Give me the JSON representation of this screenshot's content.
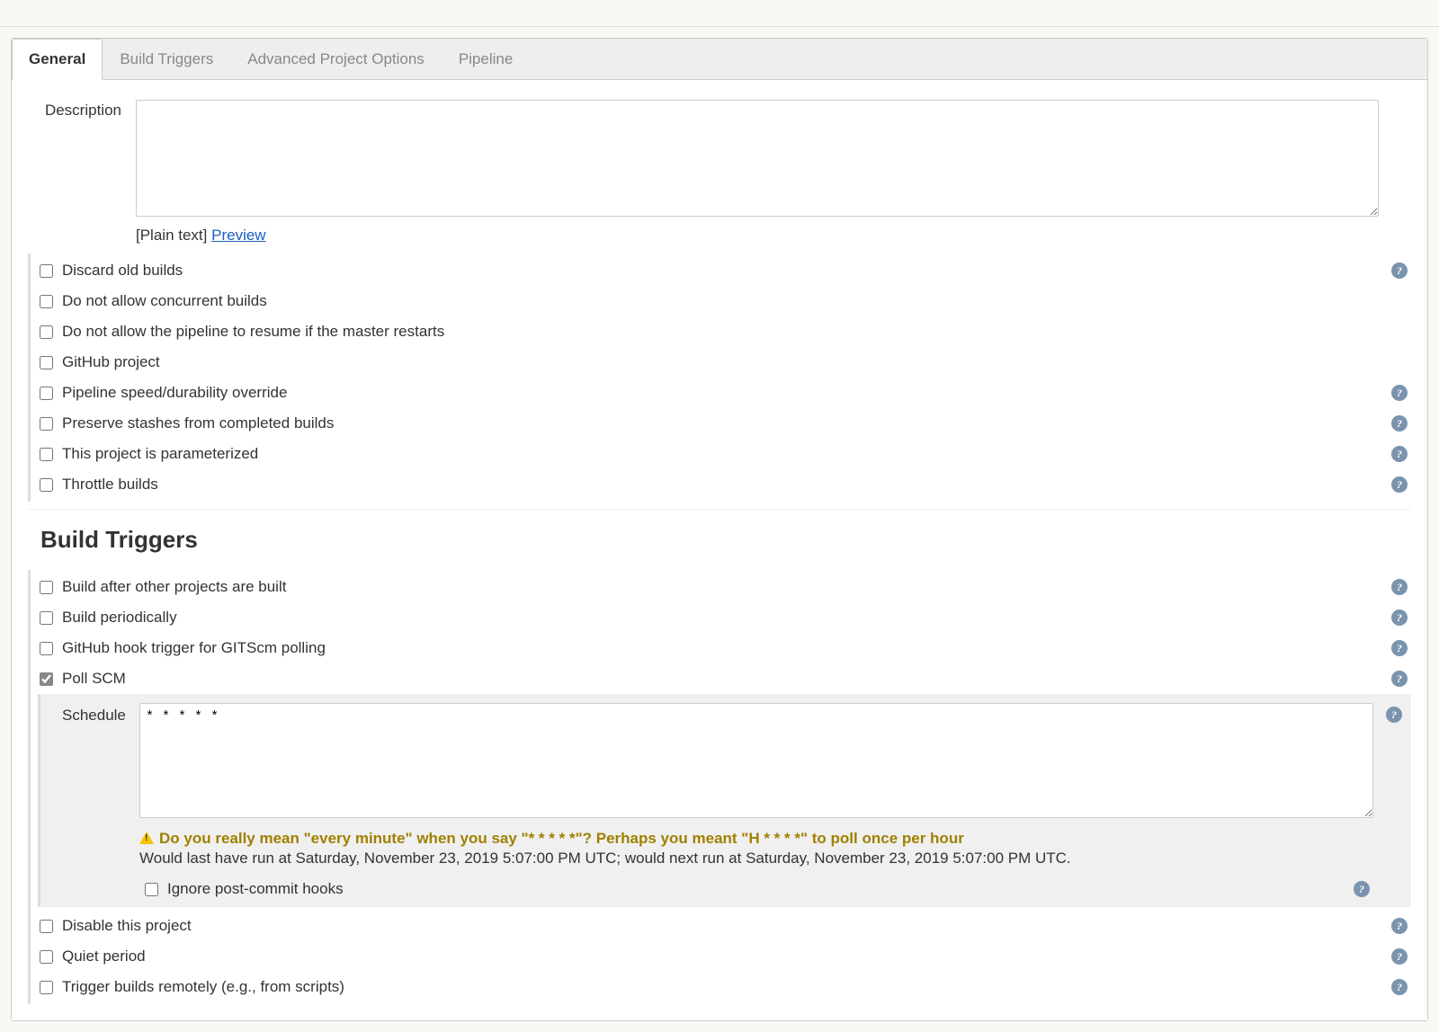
{
  "tabs": {
    "general": "General",
    "build_triggers": "Build Triggers",
    "advanced": "Advanced Project Options",
    "pipeline": "Pipeline"
  },
  "description": {
    "label": "Description",
    "value": "",
    "plain_text": "[Plain text]",
    "preview": "Preview"
  },
  "general_options": {
    "discard_old_builds": "Discard old builds",
    "no_concurrent": "Do not allow concurrent builds",
    "no_resume": "Do not allow the pipeline to resume if the master restarts",
    "github_project": "GitHub project",
    "speed_durability": "Pipeline speed/durability override",
    "preserve_stashes": "Preserve stashes from completed builds",
    "parameterized": "This project is parameterized",
    "throttle": "Throttle builds"
  },
  "build_triggers_section": {
    "heading": "Build Triggers",
    "build_after": "Build after other projects are built",
    "build_periodically": "Build periodically",
    "github_hook": "GitHub hook trigger for GITScm polling",
    "poll_scm": "Poll SCM"
  },
  "schedule": {
    "label": "Schedule",
    "value": "* * * * *",
    "warning": "Do you really mean \"every minute\" when you say \"* * * * *\"? Perhaps you meant \"H * * * *\" to poll once per hour",
    "info": "Would last have run at Saturday, November 23, 2019 5:07:00 PM UTC; would next run at Saturday, November 23, 2019 5:07:00 PM UTC.",
    "ignore_hooks": "Ignore post-commit hooks"
  },
  "more_options": {
    "disable_project": "Disable this project",
    "quiet_period": "Quiet period",
    "trigger_remote": "Trigger builds remotely (e.g., from scripts)"
  }
}
